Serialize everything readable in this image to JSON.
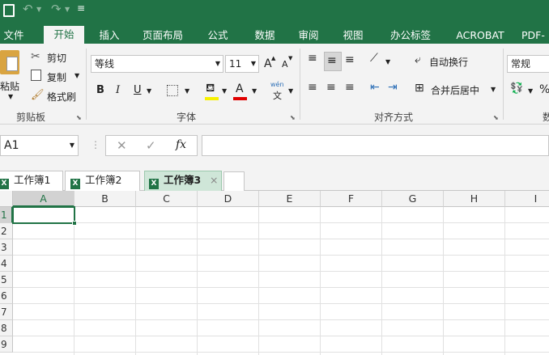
{
  "colors": {
    "brand": "#217346",
    "ribbon_bg": "#f3f3f3",
    "grid_line": "#e1e1e1"
  },
  "quick_access": {
    "app_icon": "excel-save-icon",
    "undo_icon": "undo-icon",
    "redo_icon": "redo-icon",
    "customize_icon": "dropdown-icon"
  },
  "ribbon_tabs": [
    {
      "label": "文件",
      "active": false
    },
    {
      "label": "开始",
      "active": true
    },
    {
      "label": "插入",
      "active": false
    },
    {
      "label": "页面布局",
      "active": false
    },
    {
      "label": "公式",
      "active": false
    },
    {
      "label": "数据",
      "active": false
    },
    {
      "label": "审阅",
      "active": false
    },
    {
      "label": "视图",
      "active": false
    },
    {
      "label": "办公标签",
      "active": false
    },
    {
      "label": "ACROBAT",
      "active": false
    },
    {
      "label": "PDF-",
      "active": false
    }
  ],
  "clipboard": {
    "paste": "粘贴",
    "cut": "剪切",
    "copy": "复制",
    "format_painter": "格式刷",
    "group": "剪贴板"
  },
  "font": {
    "name": "等线",
    "size": "11",
    "grow": "A",
    "shrink": "A",
    "bold": "B",
    "italic": "I",
    "underline": "U",
    "font_color": "A",
    "phonetic_top": "wén",
    "phonetic_bottom": "文",
    "group": "字体"
  },
  "alignment": {
    "wrap_text": "自动换行",
    "merge_center": "合并后居中",
    "group": "对齐方式"
  },
  "number": {
    "format": "常规",
    "percent": "%",
    "group": "数"
  },
  "formula_bar": {
    "name_box": "A1",
    "cancel": "✕",
    "enter": "✓",
    "fx": "fx",
    "formula": ""
  },
  "workbook_tabs": [
    {
      "label": "工作簿1",
      "active": false
    },
    {
      "label": "工作簿2",
      "active": false
    },
    {
      "label": "工作簿3",
      "active": true
    }
  ],
  "tab_close": "×",
  "columns": [
    "A",
    "B",
    "C",
    "D",
    "E",
    "F",
    "G",
    "H",
    "I"
  ],
  "rows": [
    "1",
    "2",
    "3",
    "4",
    "5",
    "6",
    "7",
    "8",
    "9"
  ],
  "selected_cell": "A1"
}
